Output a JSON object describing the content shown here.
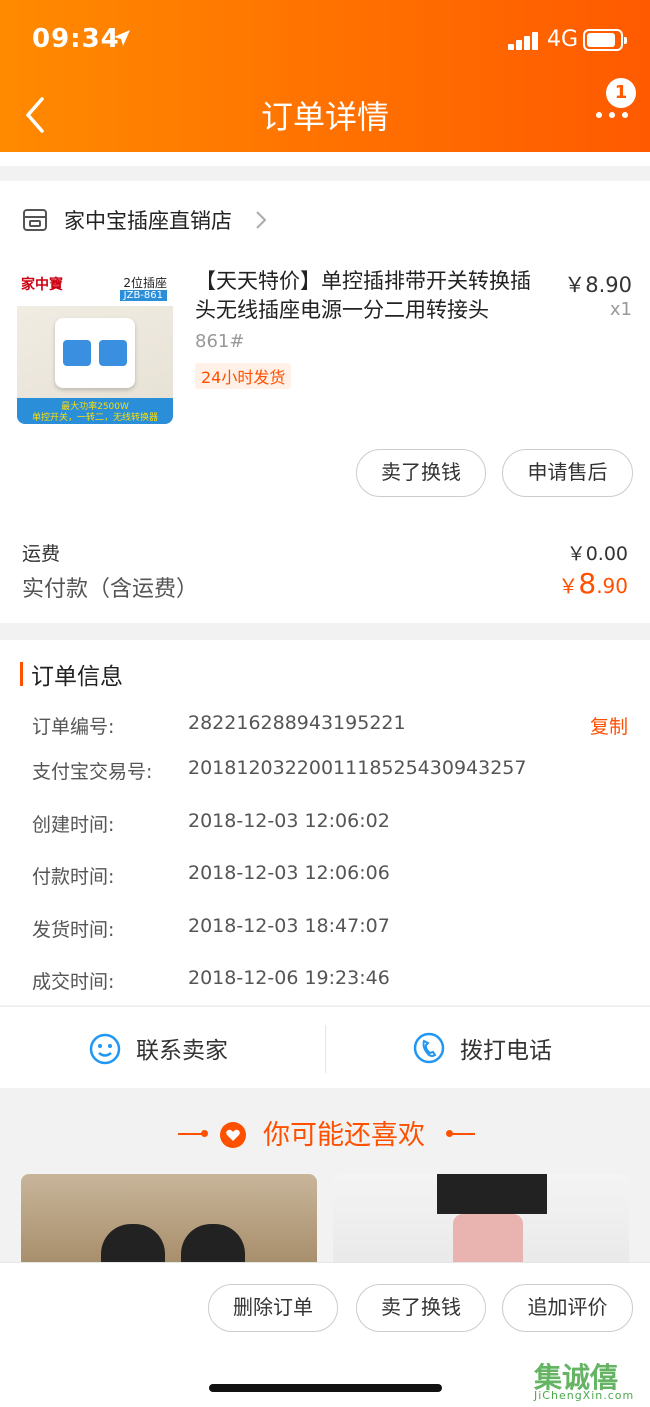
{
  "status_bar": {
    "time": "09:34",
    "network": "4G"
  },
  "header": {
    "title": "订单详情",
    "badge_count": "1"
  },
  "store": {
    "name": "家中宝插座直销店"
  },
  "product": {
    "title": "【天天特价】单控插排带开关转换插头无线插座电源一分二用转接头",
    "price": "￥8.90",
    "qty": "x1",
    "sku": "861#",
    "ship_tag": "24小时发货",
    "image": {
      "logo": "家中寶",
      "tag": "2位插座",
      "model": "JZB-861",
      "foot1": "最大功率2500W",
      "foot2": "单控开关，一转二，无线转换器"
    }
  },
  "actions": {
    "sell": "卖了换钱",
    "after_sales": "申请售后"
  },
  "fees": {
    "shipping_label": "运费",
    "shipping_value": "￥0.00",
    "paid_label": "实付款（含运费）",
    "paid_currency": "￥",
    "paid_int": "8",
    "paid_dec": ".90"
  },
  "order_info": {
    "title": "订单信息",
    "copy": "复制",
    "rows": [
      {
        "k": "订单编号:",
        "v": "282216288943195221"
      },
      {
        "k": "支付宝交易号:",
        "v": "2018120322001118525430943257"
      },
      {
        "k": "创建时间:",
        "v": "2018-12-03 12:06:02"
      },
      {
        "k": "付款时间:",
        "v": "2018-12-03 12:06:06"
      },
      {
        "k": "发货时间:",
        "v": "2018-12-03 18:47:07"
      },
      {
        "k": "成交时间:",
        "v": "2018-12-06 19:23:46"
      }
    ]
  },
  "contact": {
    "seller": "联系卖家",
    "phone": "拨打电话"
  },
  "recommend": {
    "title": "你可能还喜欢"
  },
  "bottom": {
    "delete": "删除订单",
    "sell": "卖了换钱",
    "review": "追加评价"
  },
  "watermark": {
    "text": "集诚僖",
    "url": "JiChengXin.com"
  },
  "colors": {
    "accent": "#ff5000",
    "header_start": "#ff8a00",
    "header_end": "#ff5a00"
  }
}
